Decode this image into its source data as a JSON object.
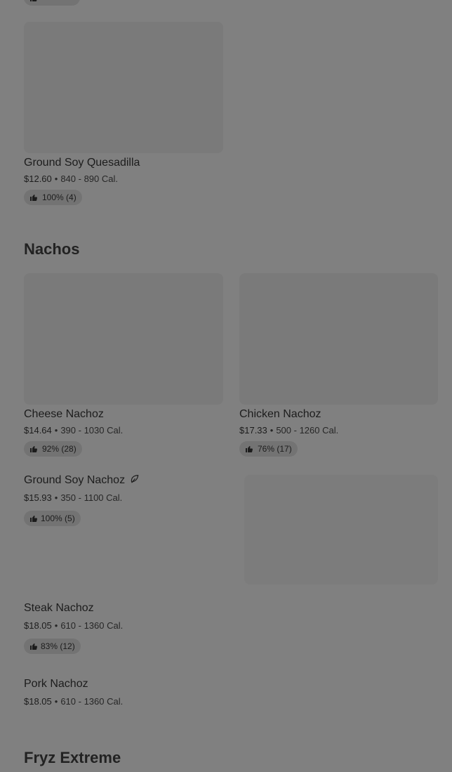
{
  "colors": {
    "background": "#808080",
    "placeholder": "#7a7a7a",
    "badge": "#737373",
    "text": "#1c1c1c"
  },
  "top_partial_badge": {
    "icon": "thumbs-up-icon"
  },
  "items_prev_section": [
    {
      "name": "Ground Soy Quesadilla",
      "price": "$12.60",
      "calories": "840 - 890 Cal.",
      "rating": "100% (4)"
    }
  ],
  "sections": [
    {
      "title": "Nachos",
      "items": [
        {
          "name": "Cheese Nachoz",
          "price": "$14.64",
          "calories": "390 - 1030 Cal.",
          "rating": "92% (28)"
        },
        {
          "name": "Chicken Nachoz",
          "price": "$17.33",
          "calories": "500 - 1260 Cal.",
          "rating": "76% (17)"
        },
        {
          "name": "Ground Soy Nachoz",
          "badge_icon": "leaf-icon",
          "price": "$15.93",
          "calories": "350 - 1100 Cal.",
          "rating": "100% (5)"
        },
        {
          "name": "Steak Nachoz",
          "price": "$18.05",
          "calories": "610 - 1360 Cal.",
          "rating": "83% (12)"
        },
        {
          "name": "Pork Nachoz",
          "price": "$18.05",
          "calories": "610 - 1360 Cal."
        }
      ]
    },
    {
      "title": "Fryz Extreme"
    }
  ],
  "separator": "•"
}
